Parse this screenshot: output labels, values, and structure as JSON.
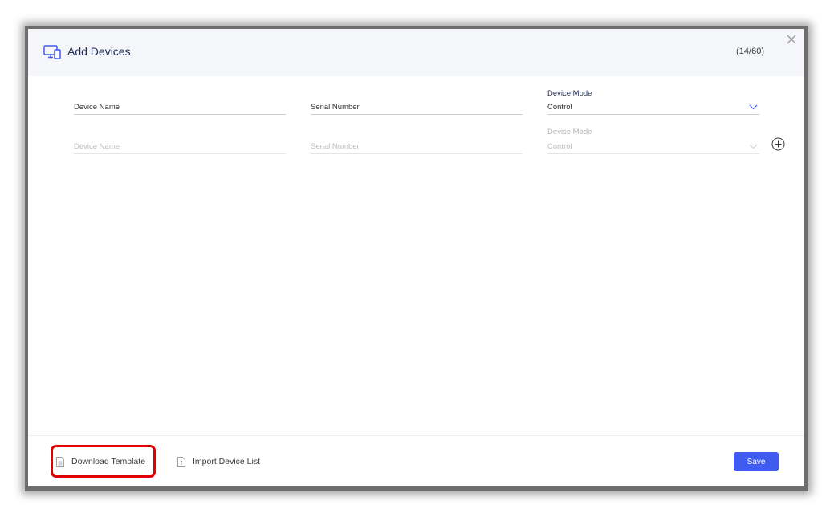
{
  "dialog": {
    "title": "Add Devices",
    "counter": "(14/60)"
  },
  "rows": [
    {
      "device_name": "Device Name",
      "serial_number": "Serial Number",
      "device_mode_label": "Device Mode",
      "device_mode_value": "Control",
      "enabled": true
    },
    {
      "device_name": "Device Name",
      "serial_number": "Serial Number",
      "device_mode_label": "Device Mode",
      "device_mode_value": "Control",
      "enabled": false
    }
  ],
  "footer": {
    "download_template": "Download Template",
    "import_device_list": "Import Device List",
    "save": "Save"
  },
  "icons": {
    "title": "devices-icon",
    "close": "close-icon",
    "add_row": "plus-circle-icon",
    "dropdown": "chevron-down-icon",
    "download": "document-icon",
    "import": "document-import-icon"
  },
  "colors": {
    "accent": "#3f5bf0",
    "highlight": "#e00000",
    "title": "#1f2a55",
    "header_bg": "#f4f6fa"
  }
}
